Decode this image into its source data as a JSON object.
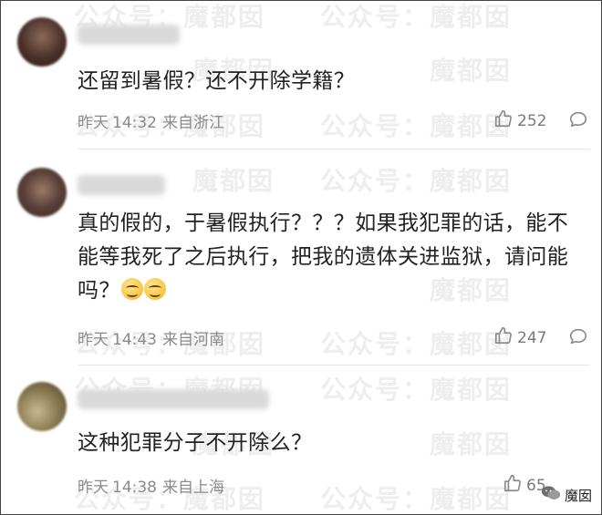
{
  "watermark": {
    "text_a": "公众号：",
    "text_b": "魔都囡"
  },
  "comments": [
    {
      "text": "还留到暑假？还不开除学籍？",
      "day": "昨天",
      "time": "14:32",
      "location": "来自浙江",
      "likes": "252"
    },
    {
      "text": "真的假的，于暑假执行？？？如果我犯罪的话，能不能等我死了之后执行，把我的遗体关进监狱，请问能吗？",
      "day": "昨天",
      "time": "14:43",
      "location": "来自河南",
      "likes": "247"
    },
    {
      "text": "这种犯罪分子不开除么？",
      "day": "昨天",
      "time": "14:38",
      "location": "来自上海",
      "likes": "65"
    }
  ],
  "brand": {
    "name": "魔囡"
  }
}
